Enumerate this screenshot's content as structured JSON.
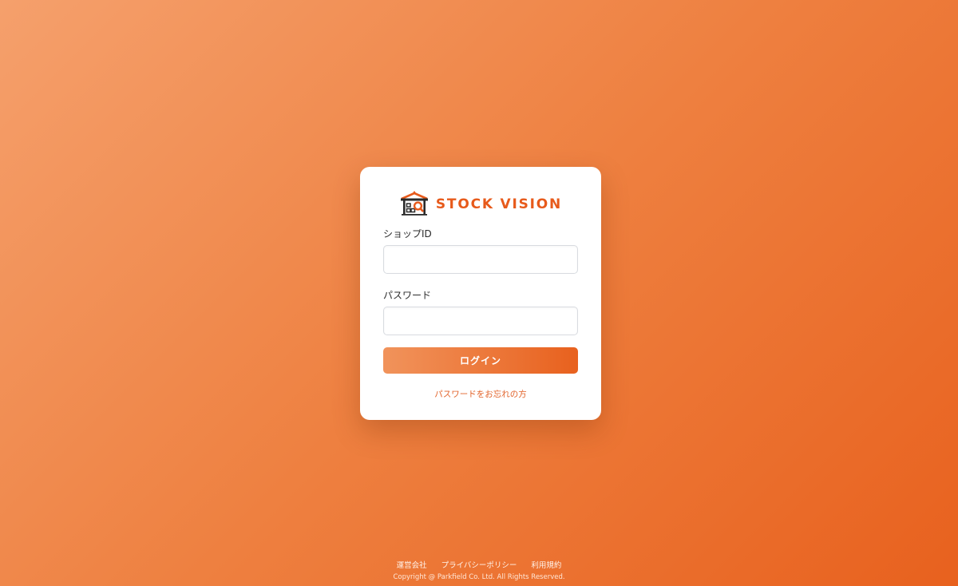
{
  "brand": {
    "name": "STOCK VISION",
    "logo_icon": "warehouse-search-icon",
    "accent_color": "#e75a1b"
  },
  "login_form": {
    "shop_id": {
      "label": "ショップID",
      "value": "",
      "placeholder": ""
    },
    "password": {
      "label": "パスワード",
      "value": "",
      "placeholder": ""
    },
    "submit_label": "ログイン",
    "forgot_password_label": "パスワードをお忘れの方"
  },
  "footer": {
    "links": [
      {
        "label": "運営会社"
      },
      {
        "label": "プライバシーポリシー"
      },
      {
        "label": "利用規約"
      }
    ],
    "copyright": "Copyright @ Parkfield Co. Ltd. All Rights Reserved."
  },
  "colors": {
    "background_start": "#f5a06c",
    "background_end": "#e8611e",
    "button_start": "#f1935b",
    "button_end": "#e8611e",
    "link": "#e2632a"
  }
}
